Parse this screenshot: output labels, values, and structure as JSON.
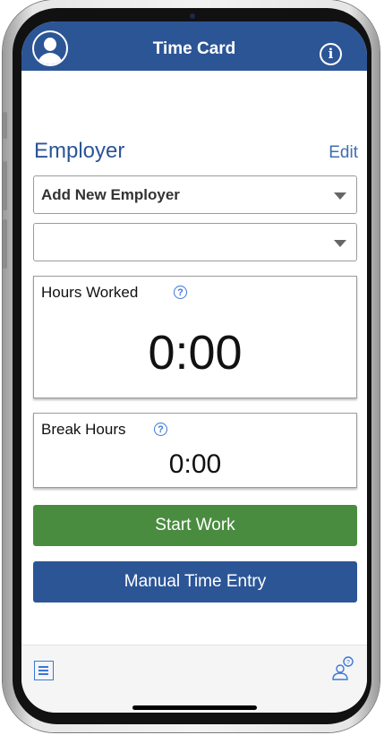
{
  "header": {
    "title": "Time Card",
    "avatar_icon": "user-avatar-icon",
    "info_icon": "info-icon",
    "info_glyph": "i"
  },
  "employer": {
    "label": "Employer",
    "edit_label": "Edit",
    "selected": "Add New Employer",
    "secondary_selected": ""
  },
  "hours_worked": {
    "label": "Hours Worked",
    "help_glyph": "?",
    "value": "0:00"
  },
  "break_hours": {
    "label": "Break Hours",
    "help_glyph": "?",
    "value": "0:00"
  },
  "buttons": {
    "start_work": "Start Work",
    "manual_entry": "Manual Time Entry"
  },
  "footer": {
    "left_icon": "list-icon",
    "right_icon": "support-chat-icon"
  },
  "colors": {
    "header": "#2c5596",
    "start_button": "#4a8c3f",
    "manual_button": "#2c5596",
    "accent": "#3a78d6"
  }
}
